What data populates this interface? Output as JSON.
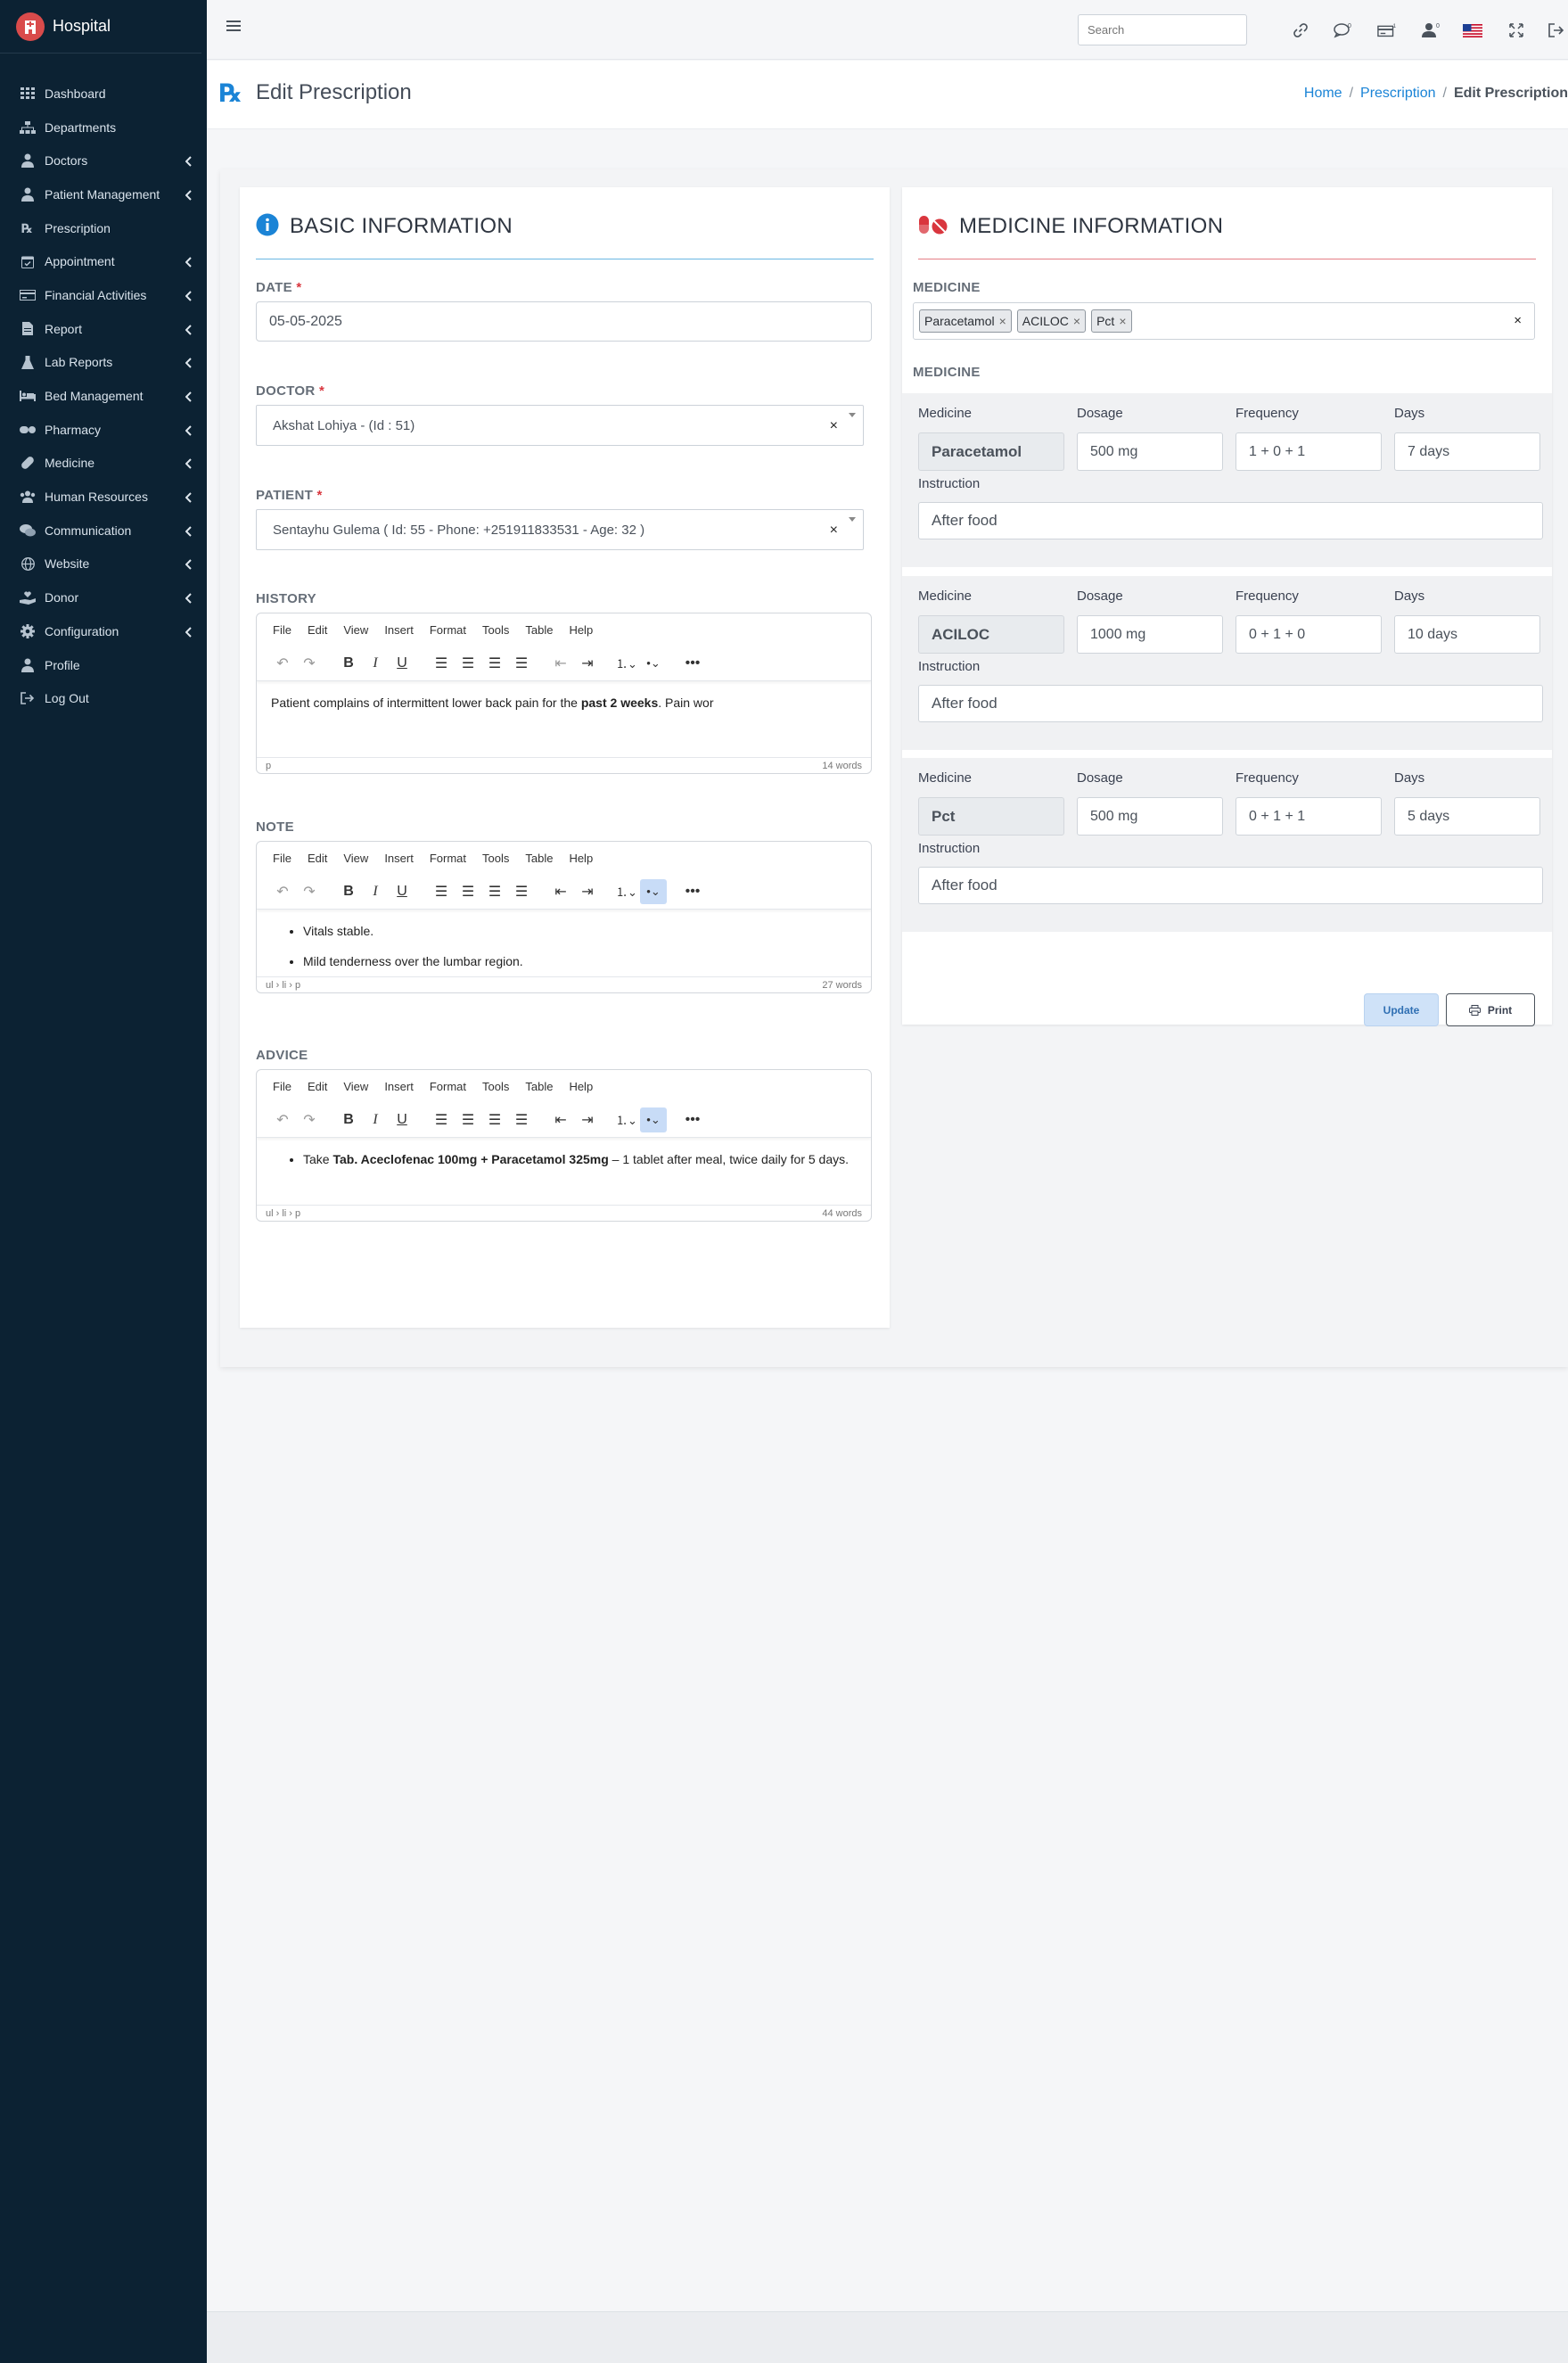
{
  "app": {
    "brand": "Hospital"
  },
  "sidebar": {
    "items": [
      {
        "label": "Dashboard",
        "icon": "grid-icon",
        "has_submenu": false
      },
      {
        "label": "Departments",
        "icon": "sitemap-icon",
        "has_submenu": false
      },
      {
        "label": "Doctors",
        "icon": "user-doctor-icon",
        "has_submenu": true
      },
      {
        "label": "Patient Management",
        "icon": "user-icon",
        "has_submenu": true
      },
      {
        "label": "Prescription",
        "icon": "prescription-icon",
        "has_submenu": false
      },
      {
        "label": "Appointment",
        "icon": "calendar-check-icon",
        "has_submenu": true
      },
      {
        "label": "Financial Activities",
        "icon": "money-icon",
        "has_submenu": true
      },
      {
        "label": "Report",
        "icon": "file-icon",
        "has_submenu": true
      },
      {
        "label": "Lab Reports",
        "icon": "flask-icon",
        "has_submenu": true
      },
      {
        "label": "Bed Management",
        "icon": "bed-icon",
        "has_submenu": true
      },
      {
        "label": "Pharmacy",
        "icon": "pills-icon",
        "has_submenu": true
      },
      {
        "label": "Medicine",
        "icon": "capsule-icon",
        "has_submenu": true
      },
      {
        "label": "Human Resources",
        "icon": "users-icon",
        "has_submenu": true
      },
      {
        "label": "Communication",
        "icon": "comments-icon",
        "has_submenu": true
      },
      {
        "label": "Website",
        "icon": "globe-icon",
        "has_submenu": true
      },
      {
        "label": "Donor",
        "icon": "hand-holding-heart-icon",
        "has_submenu": true
      },
      {
        "label": "Configuration",
        "icon": "gear-icon",
        "has_submenu": true
      },
      {
        "label": "Profile",
        "icon": "user-icon",
        "has_submenu": false
      },
      {
        "label": "Log Out",
        "icon": "sign-out-icon",
        "has_submenu": false
      }
    ]
  },
  "topbar": {
    "search_placeholder": "Search",
    "badges": {
      "messages": "0",
      "invoices": "1",
      "users": "0"
    }
  },
  "header": {
    "title": "Edit Prescription",
    "breadcrumb": {
      "home": "Home",
      "section": "Prescription",
      "current": "Edit Prescription"
    }
  },
  "basic": {
    "title": "BASIC INFORMATION",
    "date_label": "DATE",
    "date_value": "05-05-2025",
    "doctor_label": "DOCTOR",
    "doctor_value": "Akshat Lohiya - (Id : 51)",
    "patient_label": "PATIENT",
    "patient_value": "Sentayhu Gulema ( Id: 55 - Phone: +251911833531 - Age: 32 )",
    "required_mark": "*",
    "clear_symbol": "×"
  },
  "editor_menu": [
    "File",
    "Edit",
    "View",
    "Insert",
    "Format",
    "Tools",
    "Table",
    "Help"
  ],
  "history": {
    "label": "HISTORY",
    "text_before": "Patient complains of intermittent lower back pain for the ",
    "text_bold": "past 2 weeks",
    "text_after": ". Pain wor",
    "path": "p",
    "word_count": "14 words"
  },
  "note": {
    "label": "NOTE",
    "items": [
      "Vitals stable.",
      "Mild tenderness over the lumbar region."
    ],
    "path": "ul › li › p",
    "word_count": "27 words"
  },
  "advice": {
    "label": "ADVICE",
    "item_prefix": "Take ",
    "item_bold": "Tab. Aceclofenac 100mg + Paracetamol 325mg",
    "item_suffix": " – 1 tablet after meal, twice daily for 5 days.",
    "path": "ul › li › p",
    "word_count": "44 words"
  },
  "medicine": {
    "title": "MEDICINE INFORMATION",
    "select_label": "MEDICINE",
    "list_label": "MEDICINE",
    "tags": [
      "Paracetamol",
      "ACILOC",
      "Pct"
    ],
    "col_medicine": "Medicine",
    "col_dosage": "Dosage",
    "col_frequency": "Frequency",
    "col_days": "Days",
    "col_instruction": "Instruction",
    "rows": [
      {
        "name": "Paracetamol",
        "dosage": "500 mg",
        "frequency": "1 + 0 + 1",
        "days": "7 days",
        "instruction": "After food"
      },
      {
        "name": "ACILOC",
        "dosage": "1000 mg",
        "frequency": "0 + 1 + 0",
        "days": "10 days",
        "instruction": "After food"
      },
      {
        "name": "Pct",
        "dosage": "500 mg",
        "frequency": "0 + 1 + 1",
        "days": "5 days",
        "instruction": "After food"
      }
    ],
    "update_label": "Update",
    "print_label": "Print"
  },
  "colors": {
    "sidebar": "#0c2233",
    "accent": "#1b84d6",
    "danger": "#d9363e"
  }
}
